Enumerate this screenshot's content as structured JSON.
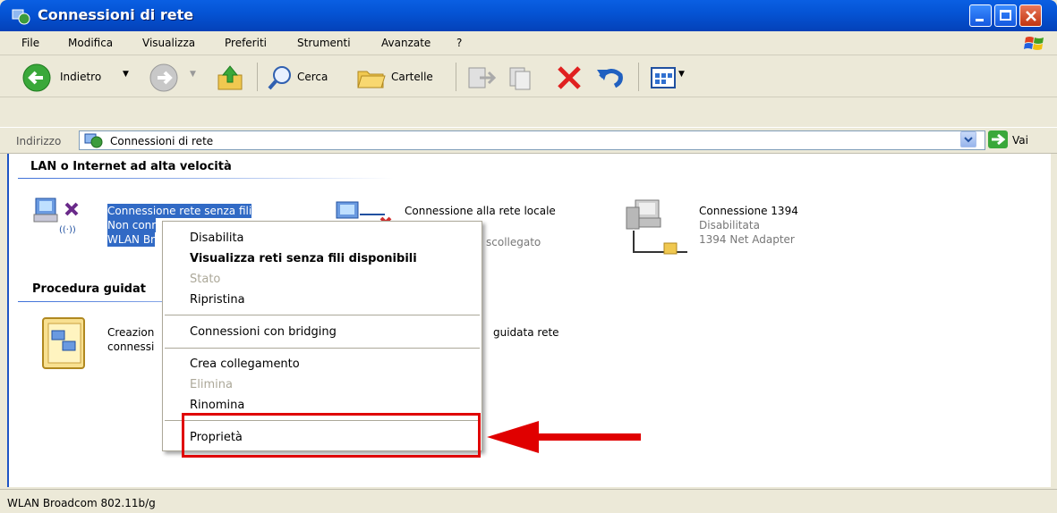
{
  "window": {
    "title": "Connessioni di rete"
  },
  "menu": [
    "File",
    "Modifica",
    "Visualizza",
    "Preferiti",
    "Strumenti",
    "Avanzate",
    "?"
  ],
  "toolbar": {
    "back_label": "Indietro",
    "search_label": "Cerca",
    "folders_label": "Cartelle"
  },
  "address": {
    "label": "Indirizzo",
    "value": "Connessioni di rete",
    "go_label": "Vai"
  },
  "groups": [
    {
      "title": "LAN o Internet ad alta velocità"
    },
    {
      "title": "Procedura guidat"
    }
  ],
  "connections": [
    {
      "name": "Connessione rete senza fili",
      "status": "Non conr",
      "device": "WLAN Br"
    },
    {
      "name": "Connessione alla rete locale",
      "status": "scollegato"
    },
    {
      "name": "Connessione 1394",
      "status": "Disabilitata",
      "device": "1394 Net Adapter"
    }
  ],
  "wizards": [
    {
      "line1": "Creazion",
      "line2": "connessi"
    },
    {
      "line1": "guidata rete"
    }
  ],
  "context_menu": {
    "items": [
      {
        "label": "Disabilita",
        "style": "normal"
      },
      {
        "label": "Visualizza reti senza fili disponibili",
        "style": "bold"
      },
      {
        "label": "Stato",
        "style": "disabled"
      },
      {
        "label": "Ripristina",
        "style": "normal"
      },
      {
        "label": "Connessioni con bridging",
        "style": "normal"
      },
      {
        "label": "Crea collegamento",
        "style": "normal"
      },
      {
        "label": "Elimina",
        "style": "disabled"
      },
      {
        "label": "Rinomina",
        "style": "normal"
      },
      {
        "label": "Proprietà",
        "style": "normal"
      }
    ]
  },
  "status_bar": {
    "text": "WLAN Broadcom 802.11b/g"
  },
  "colors": {
    "titlebar": "#0554D5",
    "selection": "#316AC5",
    "highlight": "#E00000"
  }
}
